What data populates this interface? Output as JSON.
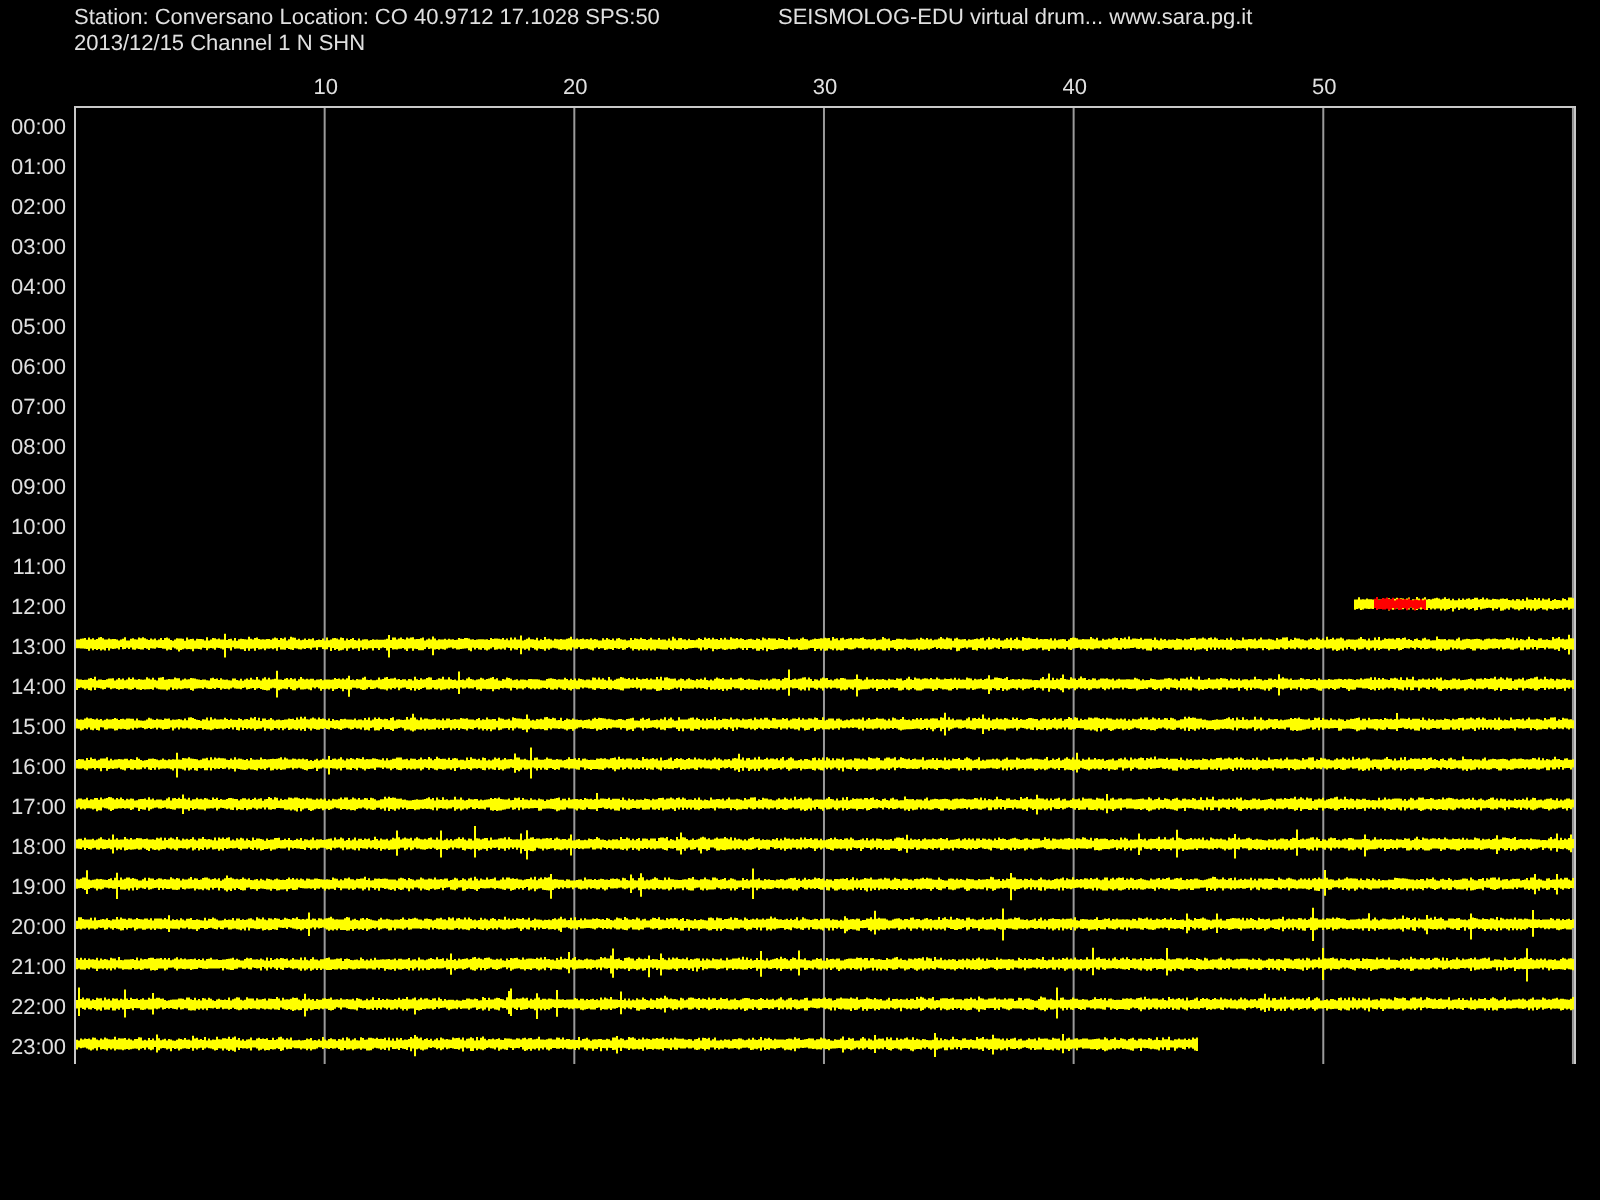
{
  "header": {
    "station": "Station: Conversano Location: CO 40.9712 17.1028 SPS:50",
    "title": "SEISMOLOG-EDU virtual drum... www.sara.pg.it",
    "date_channel": "2013/12/15  Channel 1 N SHN"
  },
  "x_ticks": [
    "10",
    "20",
    "30",
    "40",
    "50"
  ],
  "rows": [
    {
      "time": "00:00",
      "kind": "empty"
    },
    {
      "time": "01:00",
      "kind": "empty"
    },
    {
      "time": "02:00",
      "kind": "empty"
    },
    {
      "time": "03:00",
      "kind": "empty"
    },
    {
      "time": "04:00",
      "kind": "empty"
    },
    {
      "time": "05:00",
      "kind": "empty"
    },
    {
      "time": "06:00",
      "kind": "empty"
    },
    {
      "time": "07:00",
      "kind": "empty"
    },
    {
      "time": "08:00",
      "kind": "empty"
    },
    {
      "time": "09:00",
      "kind": "empty"
    },
    {
      "time": "10:00",
      "kind": "empty"
    },
    {
      "time": "11:00",
      "kind": "empty"
    },
    {
      "time": "12:00",
      "kind": "tail",
      "event": true
    },
    {
      "time": "13:00",
      "kind": "full",
      "event": false
    },
    {
      "time": "14:00",
      "kind": "full",
      "event": false
    },
    {
      "time": "15:00",
      "kind": "full",
      "event": false
    },
    {
      "time": "16:00",
      "kind": "full",
      "event": false
    },
    {
      "time": "17:00",
      "kind": "full",
      "event": false
    },
    {
      "time": "18:00",
      "kind": "full",
      "event": false
    },
    {
      "time": "19:00",
      "kind": "full",
      "event": false
    },
    {
      "time": "20:00",
      "kind": "full",
      "event": false
    },
    {
      "time": "21:00",
      "kind": "full",
      "event": false
    },
    {
      "time": "22:00",
      "kind": "full",
      "event": false
    },
    {
      "time": "23:00",
      "kind": "head",
      "event": false
    }
  ]
}
